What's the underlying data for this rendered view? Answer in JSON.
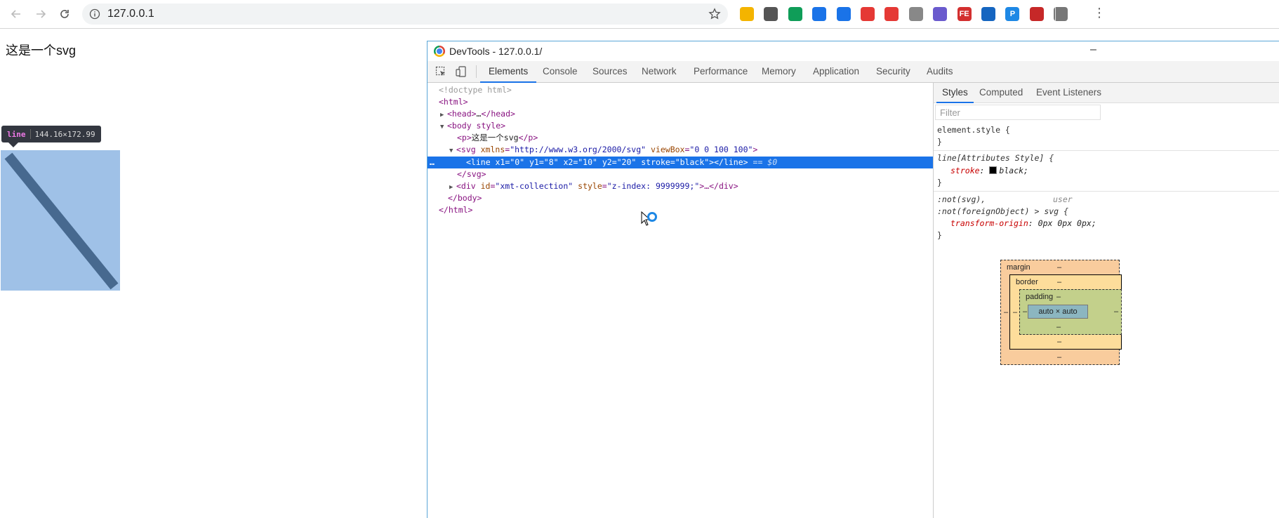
{
  "browser": {
    "url": "127.0.0.1",
    "icons": [
      "back-arrow-icon",
      "forward-arrow-icon",
      "reload-icon",
      "info-icon",
      "star-icon"
    ],
    "extensions": [
      {
        "name": "ext-multicolor",
        "color": "#f4b400"
      },
      {
        "name": "ext-gray",
        "color": "#555555"
      },
      {
        "name": "ext-green-shield",
        "color": "#0f9d58"
      },
      {
        "name": "ext-compass",
        "color": "#1a73e8"
      },
      {
        "name": "ext-question",
        "color": "#1a73e8"
      },
      {
        "name": "ext-map-pin",
        "color": "#e53935"
      },
      {
        "name": "ext-red-circle",
        "color": "#e53935"
      },
      {
        "name": "ext-rocket",
        "color": "#888888"
      },
      {
        "name": "ext-cat",
        "color": "#6a5acd"
      },
      {
        "name": "ext-fe",
        "color": "#d32f2f",
        "text": "FE"
      },
      {
        "name": "ext-ruler",
        "color": "#1565c0"
      },
      {
        "name": "ext-p",
        "color": "#1e88e5",
        "text": "P"
      },
      {
        "name": "ext-red-stop",
        "color": "#c62828"
      },
      {
        "name": "ext-tools",
        "color": "#777777"
      }
    ]
  },
  "page": {
    "paragraph": "这是一个svg",
    "tooltip": {
      "tag": "line",
      "size": "144.16×172.99"
    },
    "highlight_color": "#9fc1e7",
    "line_color": "#47698f"
  },
  "devtools": {
    "title": "DevTools - 127.0.0.1/",
    "minimize": "–",
    "tabs": [
      "Elements",
      "Console",
      "Sources",
      "Network",
      "Performance",
      "Memory",
      "Application",
      "Security",
      "Audits"
    ],
    "active_tab": "Elements",
    "dom": {
      "doctype": "<!doctype html>",
      "html_open": "<html>",
      "head_open": "<head>",
      "head_ellipsis": "…",
      "head_close": "</head>",
      "body_open": "<body style>",
      "p_open": "<p>",
      "p_text": "这是一个svg",
      "p_close": "</p>",
      "svg_open": "<svg ",
      "svg_attr1_name": "xmlns",
      "svg_attr1_val": "\"http://www.w3.org/2000/svg\"",
      "svg_attr2_name": "viewBox",
      "svg_attr2_val": "\"0 0 100 100\"",
      "svg_open_end": ">",
      "line_html": "<line x1=\"0\" y1=\"8\" x2=\"10\" y2=\"20\" stroke=\"black\"></line>",
      "line_eq": "== $0",
      "line_dots": "…",
      "svg_close": "</svg>",
      "div_open": "<div ",
      "div_attr1_name": "id",
      "div_attr1_val": "\"xmt-collection\"",
      "div_attr2_name": "style",
      "div_attr2_val": "\"z-index: 9999999;\"",
      "div_tail": ">…</div>",
      "body_close": "</body>",
      "html_close": "</html>"
    },
    "styles": {
      "subtabs": [
        "Styles",
        "Computed",
        "Event Listeners"
      ],
      "active_subtab": "Styles",
      "filter_placeholder": "Filter",
      "element_style_open": "element.style {",
      "brace_close": "}",
      "rule1_selector": "line[Attributes Style] {",
      "rule1_prop": "stroke",
      "rule1_val": "black;",
      "rule2_selector1": ":not(svg),",
      "rule2_origin": "user",
      "rule2_selector2": ":not(foreignObject) > svg {",
      "rule2_prop": "transform-origin",
      "rule2_val": "0px 0px 0px;",
      "colon": ":"
    },
    "box_model": {
      "margin": "margin",
      "border": "border",
      "padding": "padding",
      "content": "auto × auto",
      "dash": "–"
    }
  }
}
